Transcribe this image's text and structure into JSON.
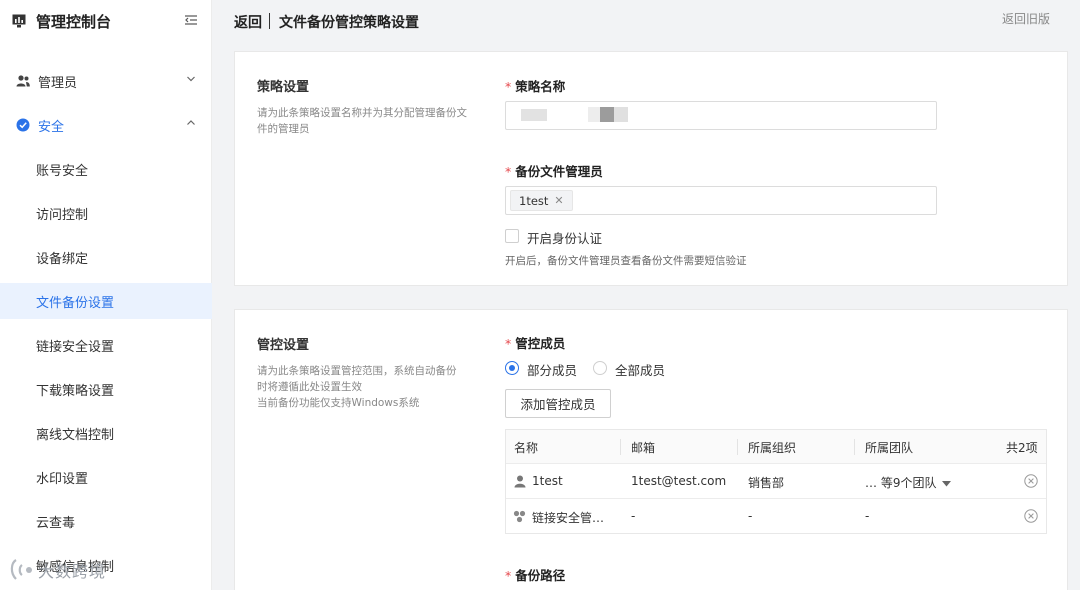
{
  "app": {
    "title": "管理控制台"
  },
  "sidebar": {
    "groups": [
      {
        "label": "管理员",
        "icon": "users-icon",
        "expanded": false
      },
      {
        "label": "安全",
        "icon": "shield-check-icon",
        "expanded": true
      }
    ],
    "items": [
      {
        "label": "账号安全"
      },
      {
        "label": "访问控制"
      },
      {
        "label": "设备绑定"
      },
      {
        "label": "文件备份设置",
        "selected": true
      },
      {
        "label": "链接安全设置"
      },
      {
        "label": "下载策略设置"
      },
      {
        "label": "离线文档控制"
      },
      {
        "label": "水印设置"
      },
      {
        "label": "云查毒"
      },
      {
        "label": "敏感信息控制"
      }
    ]
  },
  "header": {
    "back": "返回",
    "title": "文件备份管控策略设置",
    "old_version": "返回旧版"
  },
  "policy_section": {
    "title": "策略设置",
    "desc": "请为此条策略设置名称并为其分配管理备份文件的管理员",
    "name_label": "策略名称",
    "admin_label": "备份文件管理员",
    "admin_tags": [
      "1test"
    ],
    "auth_label": "开启身份认证",
    "auth_checked": false,
    "auth_hint": "开启后，备份文件管理员查看备份文件需要短信验证"
  },
  "control_section": {
    "title": "管控设置",
    "desc_lines": [
      "请为此条策略设置管控范围，系统自动备份",
      "时将遵循此处设置生效",
      "当前备份功能仅支持Windows系统"
    ],
    "members_label": "管控成员",
    "radio_options": [
      "部分成员",
      "全部成员"
    ],
    "radio_selected": "部分成员",
    "add_button": "添加管控成员",
    "table": {
      "columns": [
        "名称",
        "邮箱",
        "所属组织",
        "所属团队"
      ],
      "total": "共2项",
      "rows": [
        {
          "icon": "user-icon",
          "name": "1test",
          "email": "1test@test.com",
          "org": "销售部",
          "team": "… 等9个团队"
        },
        {
          "icon": "group-icon",
          "name": "链接安全管…",
          "email": "-",
          "org": "-",
          "team": "-"
        }
      ]
    },
    "path_label": "备份路径"
  },
  "watermark": {
    "text": "大数跨境"
  },
  "colors": {
    "primary": "#2b73e8",
    "required": "#e5484d",
    "selected_bg": "#eaf2fe"
  }
}
